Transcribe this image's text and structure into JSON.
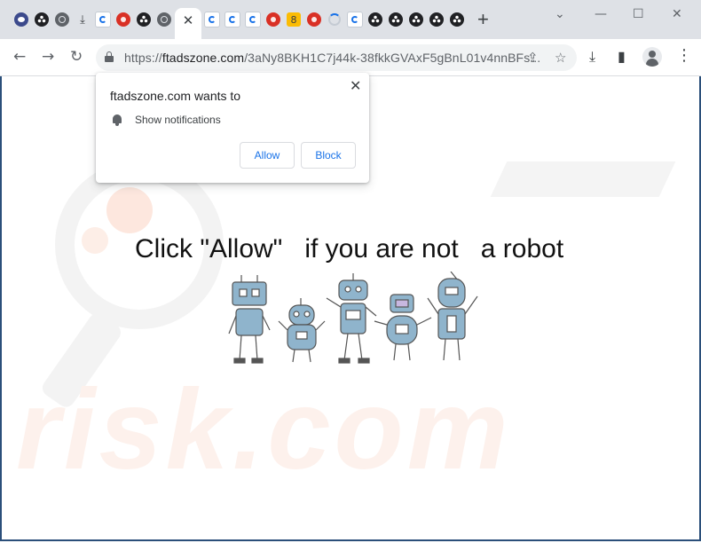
{
  "tabs": {
    "favicons": [
      "dark-logo",
      "reel",
      "reel",
      "globe",
      "download",
      "refresh",
      "red",
      "reel",
      "globe",
      "refresh",
      "refresh",
      "refresh",
      "red",
      "yellow",
      "red",
      "spinner",
      "refresh",
      "reel",
      "reel",
      "reel",
      "reel",
      "reel"
    ],
    "active_close": "✕",
    "new_tab": "+"
  },
  "window_controls": {
    "minimize": "⌄",
    "restore": "—",
    "maximize": "☐",
    "close": "✕"
  },
  "toolbar": {
    "back": "←",
    "forward": "→",
    "reload": "↻",
    "url_scheme": "https://",
    "url_host": "ftadszone.com",
    "url_path": "/3aNy8BKH1C7j44k-38fkkGVAxF5gBnL01v4nnBFs...",
    "share": "⇪",
    "bookmark": "☆",
    "downloads": "⤓",
    "side_panel": "▮",
    "menu": "⋮"
  },
  "popup": {
    "title": "ftadszone.com wants to",
    "permission": "Show notifications",
    "allow": "Allow",
    "block": "Block",
    "close": "✕"
  },
  "page": {
    "headline": "Click \"Allow\"   if you are not   a robot"
  },
  "watermark": {
    "text": "risk.com"
  },
  "colors": {
    "accent": "#1a73e8",
    "frame": "#2b4f7a",
    "tabstrip": "#dee1e6",
    "robot": "#8fb4cc"
  }
}
